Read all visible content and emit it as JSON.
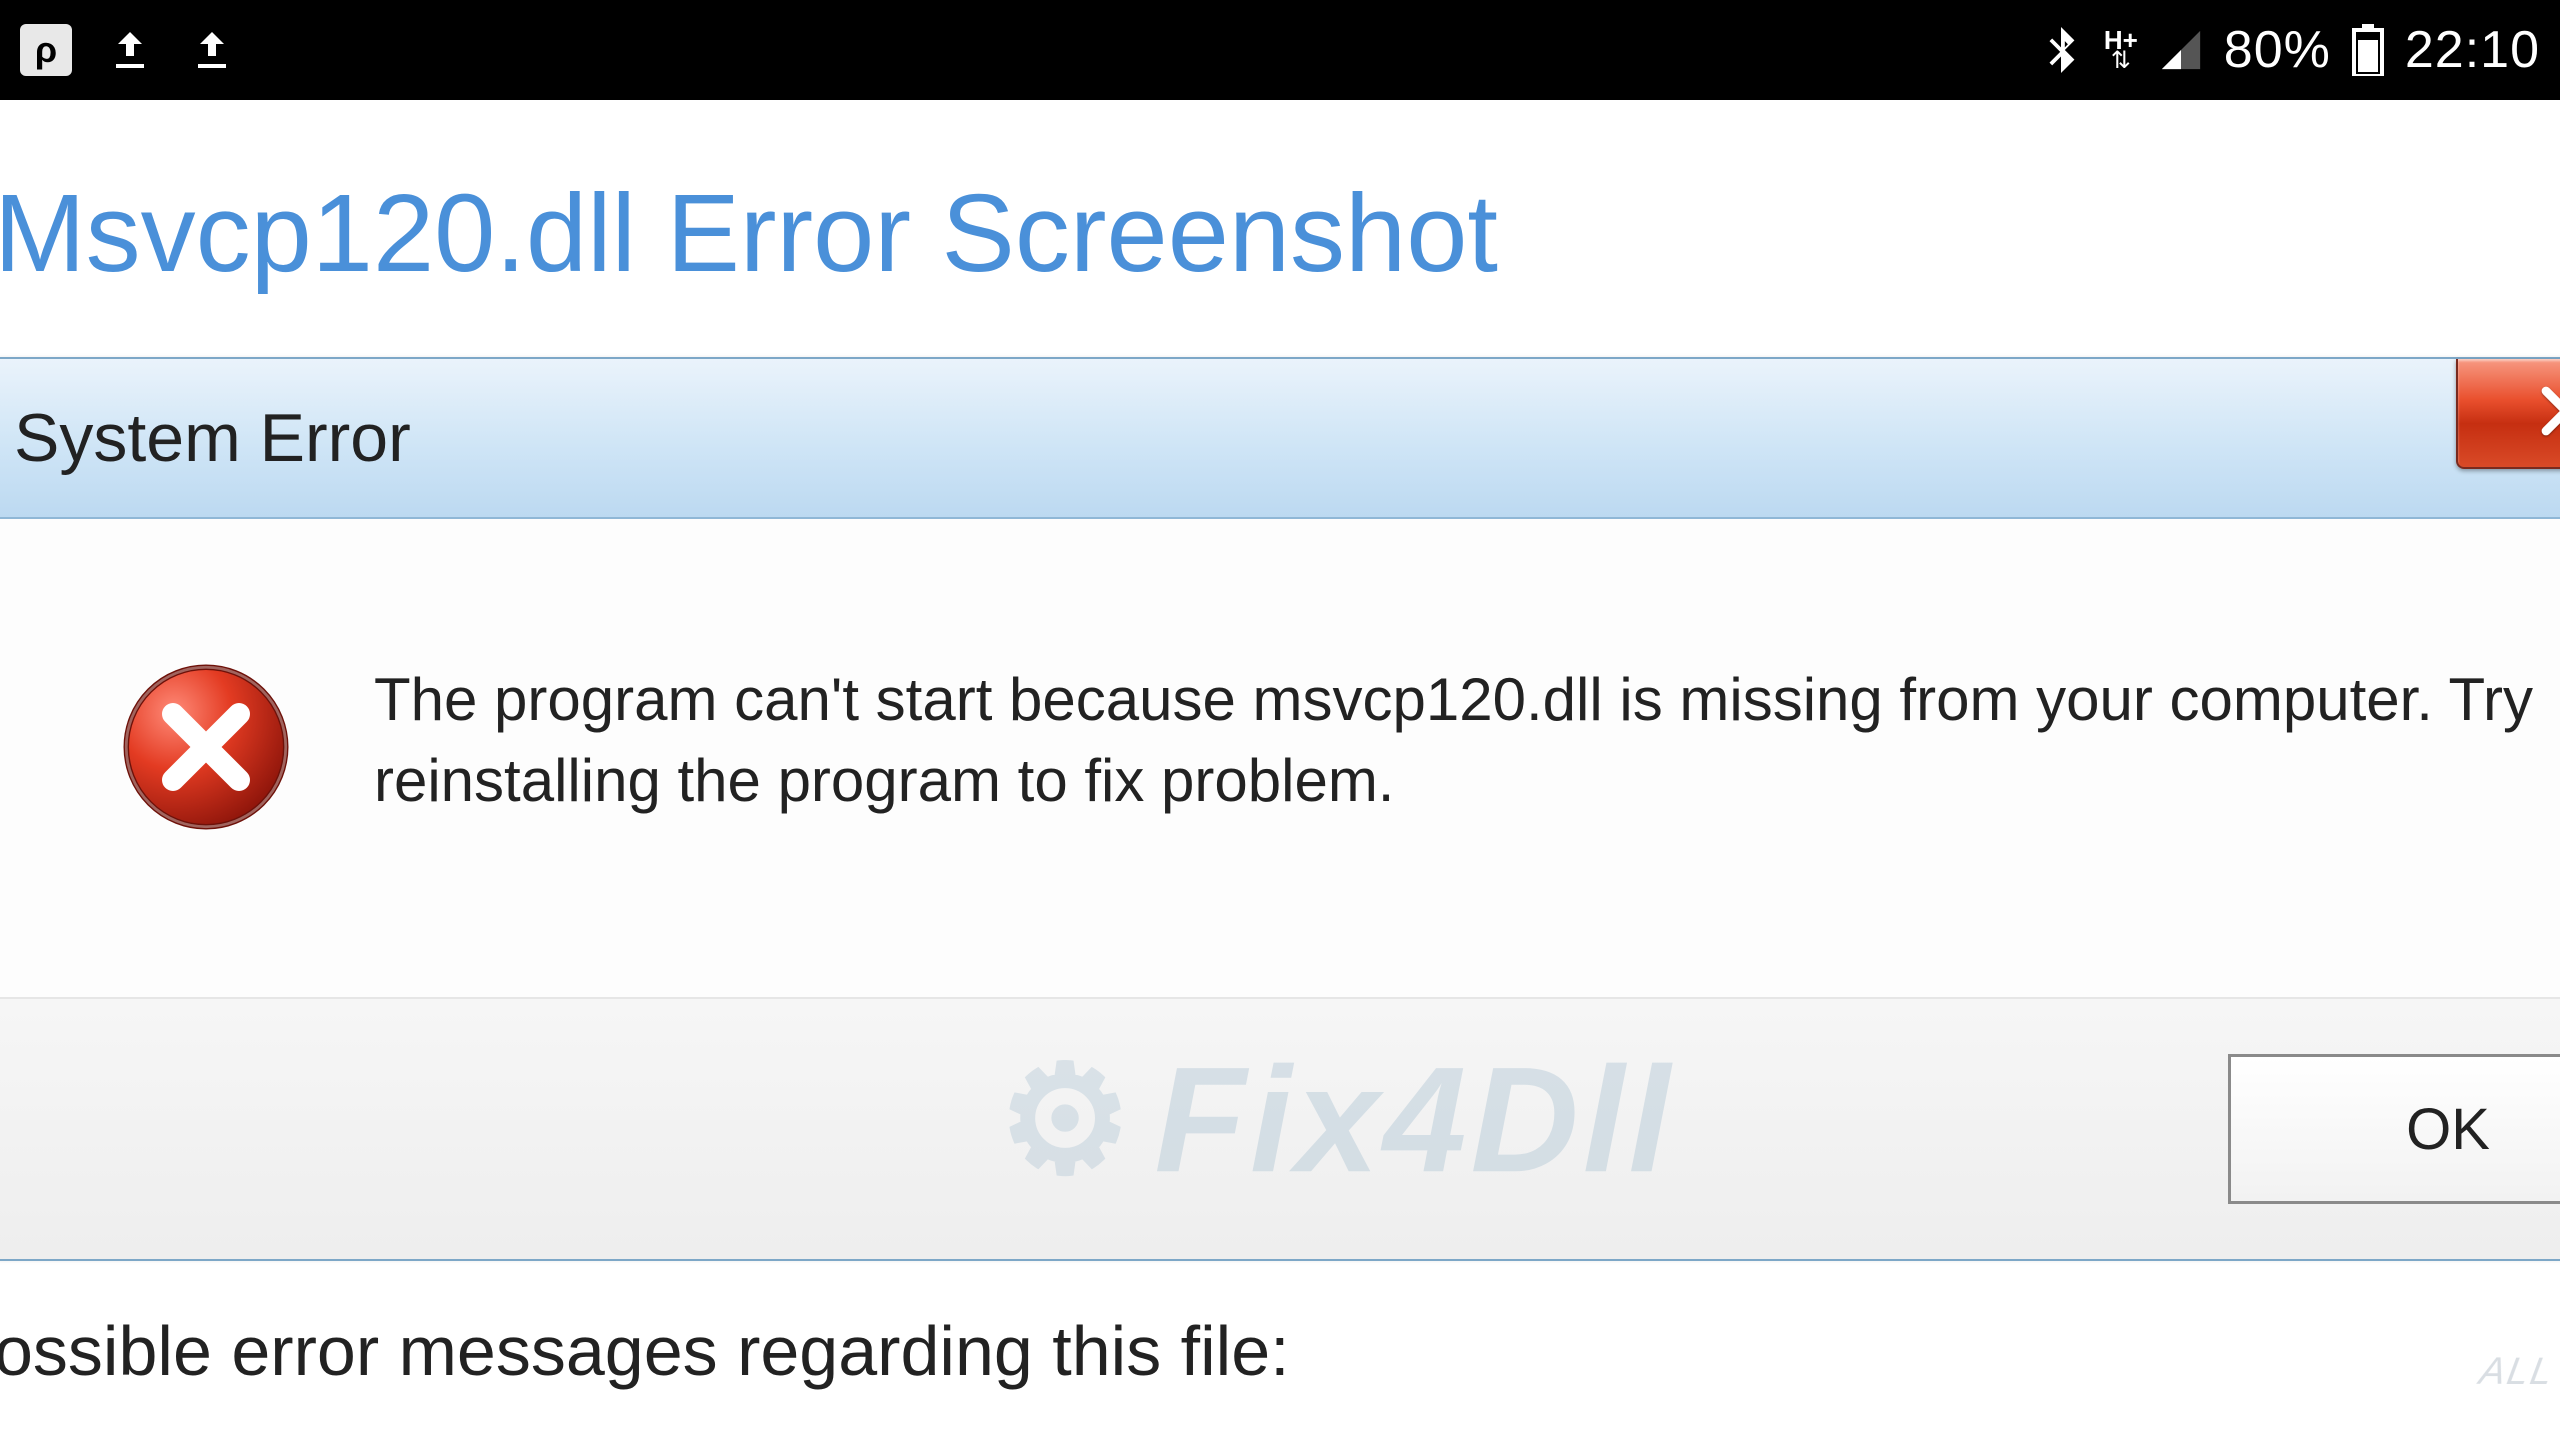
{
  "statusbar": {
    "app_letter": "ρ",
    "battery_pct": "80%",
    "clock": "22:10",
    "h_plus": "H+"
  },
  "page": {
    "heading": "Msvcp120.dll Error Screenshot",
    "bottom_partial": "ossible error messages regarding this file:"
  },
  "dialog": {
    "title": "System Error",
    "message": "The program can't start because msvcp120.dll is missing from your computer. Try reinstalling the program to fix problem.",
    "ok_label": "OK",
    "watermark": "Fix4Dll"
  },
  "corner_watermark": "ALL"
}
